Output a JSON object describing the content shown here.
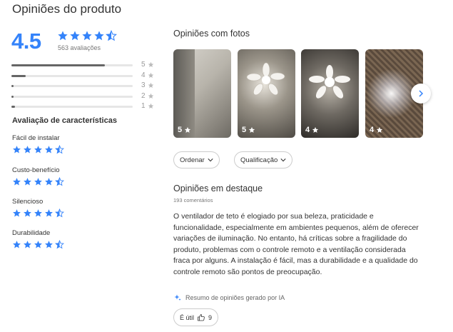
{
  "header": {
    "title": "Opiniões do produto"
  },
  "summary": {
    "average": "4.5",
    "average_value": 4.5,
    "total_label": "563 avaliações",
    "distribution": [
      {
        "label": "5",
        "fraction": 0.77
      },
      {
        "label": "4",
        "fraction": 0.12
      },
      {
        "label": "3",
        "fraction": 0.02
      },
      {
        "label": "2",
        "fraction": 0.02
      },
      {
        "label": "1",
        "fraction": 0.03
      }
    ]
  },
  "characteristics": {
    "title": "Avaliação de características",
    "items": [
      {
        "name": "Fácil de instalar",
        "rating": 4.5
      },
      {
        "name": "Custo-benefício",
        "rating": 4.5
      },
      {
        "name": "Silencioso",
        "rating": 4.5
      },
      {
        "name": "Durabilidade",
        "rating": 4.5
      }
    ]
  },
  "photos": {
    "title": "Opiniões com fotos",
    "items": [
      {
        "rating": "5",
        "icon": "star-icon"
      },
      {
        "rating": "5",
        "icon": "star-icon"
      },
      {
        "rating": "4",
        "icon": "star-icon"
      },
      {
        "rating": "4",
        "icon": "star-icon"
      }
    ],
    "next_icon": "chevron-right-icon"
  },
  "filters": {
    "sort_label": "Ordenar",
    "rating_label": "Qualificação"
  },
  "featured": {
    "title": "Opiniões em destaque",
    "comments_label": "193 comentários",
    "summary_text": "O ventilador de teto é elogiado por sua beleza, praticidade e funcionalidade, especialmente em ambientes pequenos, além de oferecer variações de iluminação. No entanto, há críticas sobre a fragilidade do produto, problemas com o controle remoto e a ventilação considerada fraca por alguns. A instalação é fácil, mas a durabilidade e a qualidade do controle remoto são pontos de preocupação.",
    "ai_label": "Resumo de opiniões gerado por IA",
    "useful_label": "É útil",
    "useful_count": "9"
  },
  "colors": {
    "accent": "#3483fa",
    "bar_fill": "#666666",
    "bar_track": "#e6e6e6"
  }
}
